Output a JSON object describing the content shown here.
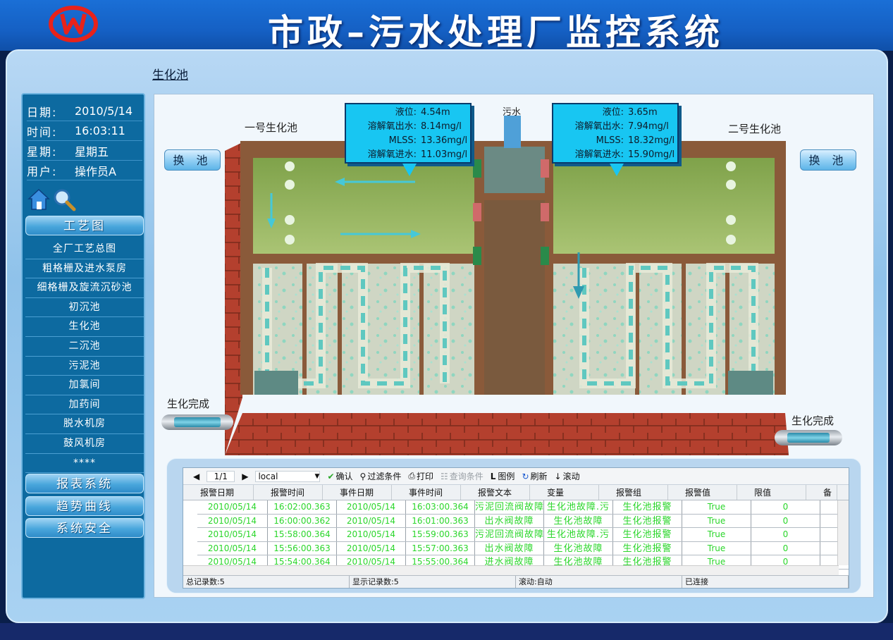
{
  "header": {
    "system_title": "市政–污水处理厂监控系统",
    "page_title": "生化池"
  },
  "info": {
    "date_label": "日期:",
    "date_value": "2010/5/14",
    "time_label": "时间:",
    "time_value": "16:03:11",
    "weekday_label": "星期:",
    "weekday_value": "星期五",
    "user_label": "用户:",
    "user_value": "操作员A"
  },
  "sidebar": {
    "process_button": "工艺图",
    "nav": [
      "全厂工艺总图",
      "粗格栅及进水泵房",
      "细格栅及旋流沉砂池",
      "初沉池",
      "生化池",
      "二沉池",
      "污泥池",
      "加氯间",
      "加药间",
      "脱水机房",
      "鼓风机房",
      "****"
    ],
    "report_button": "报表系统",
    "trend_button": "趋势曲线",
    "security_button": "系统安全"
  },
  "process": {
    "tank1_label": "一号生化池",
    "tank2_label": "二号生化池",
    "sewage_label": "污水",
    "swap_left": "换 池",
    "swap_right": "换 池",
    "complete_left": "生化完成",
    "complete_right": "生化完成",
    "tank1": {
      "level_label": "液位:",
      "level_value": "4.54m",
      "do_out_label": "溶解氧出水:",
      "do_out_value": "8.14mg/l",
      "mlss_label": "MLSS:",
      "mlss_value": "13.36mg/l",
      "do_in_label": "溶解氧进水:",
      "do_in_value": "11.03mg/l"
    },
    "tank2": {
      "level_label": "液位:",
      "level_value": "3.65m",
      "do_out_label": "溶解氧出水:",
      "do_out_value": "7.94mg/l",
      "mlss_label": "MLSS:",
      "mlss_value": "18.32mg/l",
      "do_in_label": "溶解氧进水:",
      "do_in_value": "15.90mg/l"
    }
  },
  "alarm": {
    "page": "1/1",
    "source": "local",
    "toolbar": {
      "confirm": "确认",
      "filter": "过滤条件",
      "print": "打印",
      "query": "查询条件",
      "legend": "图例",
      "refresh": "刷新",
      "scroll": "滚动"
    },
    "columns": [
      "报警日期",
      "报警时间",
      "事件日期",
      "事件时间",
      "报警文本",
      "变量",
      "报警组",
      "报警值",
      "限值",
      "备"
    ],
    "rows": [
      [
        "2010/05/14",
        "16:02:00.363",
        "2010/05/14",
        "16:03:00.364",
        "污泥回流阀故障",
        "生化池故障.污",
        "生化池报警",
        "True",
        "0"
      ],
      [
        "2010/05/14",
        "16:00:00.362",
        "2010/05/14",
        "16:01:00.363",
        "出水阀故障",
        "生化池故障",
        "生化池报警",
        "True",
        "0"
      ],
      [
        "2010/05/14",
        "15:58:00.364",
        "2010/05/14",
        "15:59:00.363",
        "污泥回流阀故障",
        "生化池故障.污",
        "生化池报警",
        "True",
        "0"
      ],
      [
        "2010/05/14",
        "15:56:00.363",
        "2010/05/14",
        "15:57:00.363",
        "出水阀故障",
        "生化池故障",
        "生化池报警",
        "True",
        "0"
      ],
      [
        "2010/05/14",
        "15:54:00.364",
        "2010/05/14",
        "15:55:00.364",
        "进水阀故障",
        "生化池故障",
        "生化池报警",
        "True",
        "0"
      ]
    ],
    "status": {
      "total": "总记录数:5",
      "shown": "显示记录数:5",
      "scroll": "滚动:自动",
      "conn": "已连接"
    }
  }
}
